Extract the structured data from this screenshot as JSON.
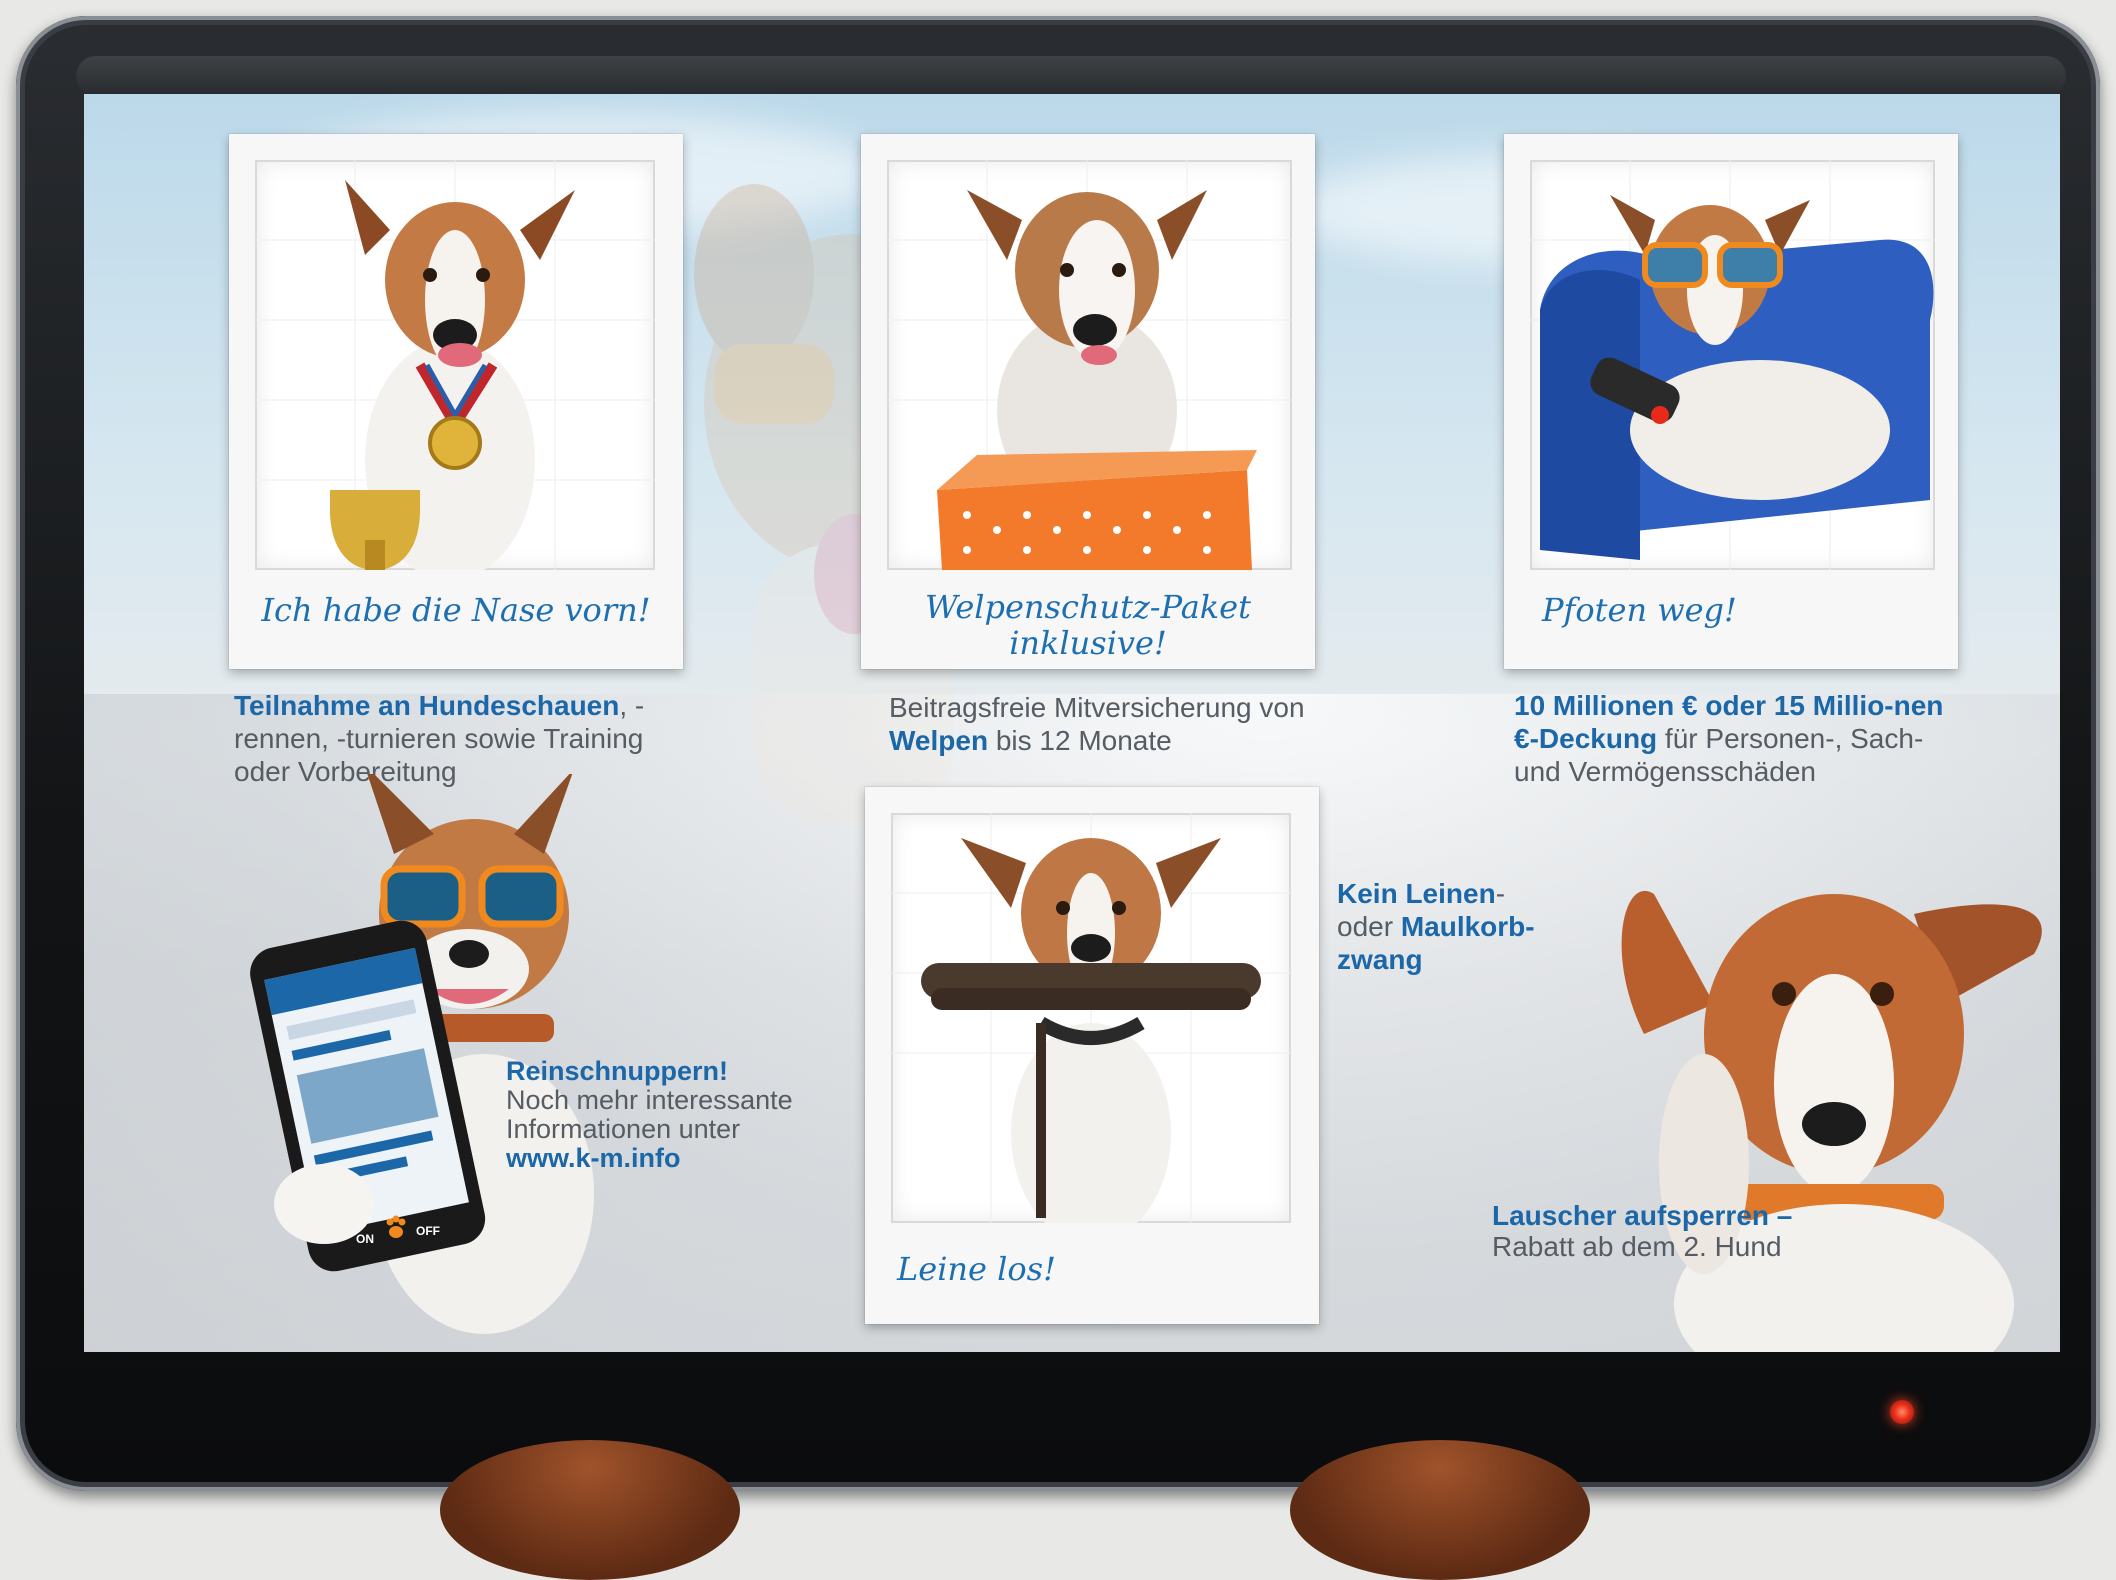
{
  "cards": {
    "show": {
      "caption": "Ich habe die Nase vorn!",
      "text_bold": "Teilnahme an Hundeschauen",
      "text_rest": ", -rennen, -turnieren sowie Training oder Vorbereitung"
    },
    "puppy": {
      "caption_line1": "Welpenschutz-Paket",
      "caption_line2": "inklusive!",
      "text_a": "Beitragsfreie",
      "text_b": " Mitversicherung von ",
      "text_bold": "Welpen",
      "text_c": " bis 12 Monate"
    },
    "coverage": {
      "caption": "Pfoten weg!",
      "text_bold": "10 Millionen € oder 15 Millio-nen €-Deckung",
      "text_rest": " für Personen-, Sach- und Vermögensschäden"
    },
    "leash": {
      "caption": "Leine los!"
    }
  },
  "leash_text": {
    "bold1": "Kein Leinen",
    "rest1": "-",
    "rest2": "oder ",
    "bold2": "Maulkorb-",
    "bold3": "zwang"
  },
  "website": {
    "title": "Reinschnuppern!",
    "line1": "Noch mehr interessante",
    "line2": "Informationen unter",
    "url": "www.k-m.info"
  },
  "discount": {
    "title": "Lauscher aufsperren –",
    "text": "Rabatt ab dem 2. Hund"
  },
  "phone": {
    "toggle_on": "ON",
    "toggle_off": "OFF"
  },
  "colors": {
    "accent_blue": "#1c67a8",
    "caption_blue": "#1e6fb2",
    "body_text": "#555c63",
    "led_red": "#e8301a"
  },
  "icons": [
    "paw-icon",
    "medal-icon",
    "trophy-icon",
    "remote-icon",
    "leash-icon",
    "sunglasses-icon",
    "power-led-icon"
  ]
}
